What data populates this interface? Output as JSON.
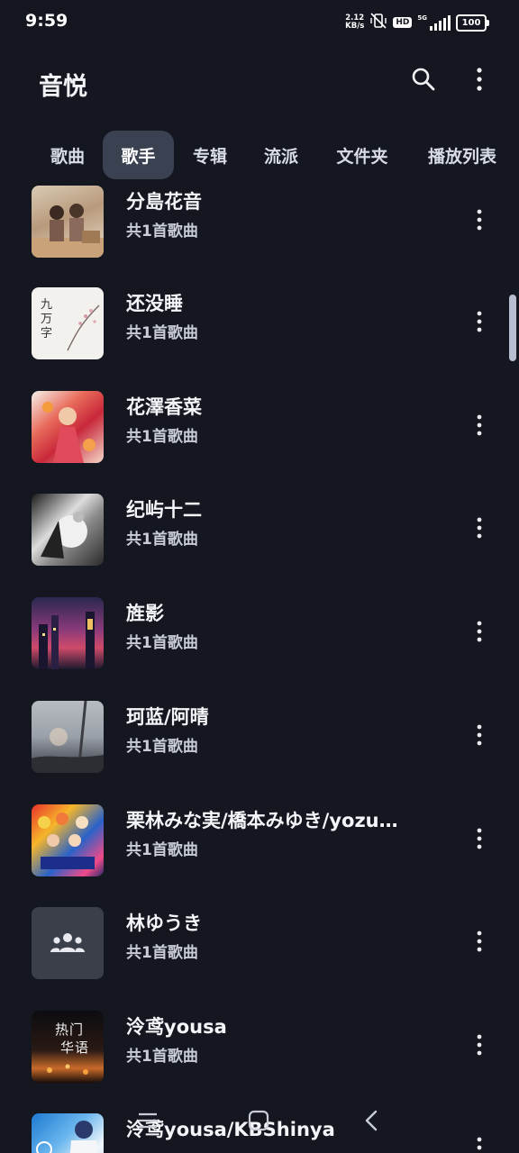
{
  "status_bar": {
    "time": "9:59",
    "net_speed_value": "2.12",
    "net_speed_unit": "KB/s",
    "hd_label": "HD",
    "signal_label": "5G",
    "battery": "100"
  },
  "app_bar": {
    "title": "音悦",
    "icons": [
      "search-icon",
      "more-vert-icon"
    ]
  },
  "tabs": [
    {
      "label": "歌曲",
      "active": false
    },
    {
      "label": "歌手",
      "active": true
    },
    {
      "label": "专辑",
      "active": false
    },
    {
      "label": "流派",
      "active": false
    },
    {
      "label": "文件夹",
      "active": false
    },
    {
      "label": "播放列表",
      "active": false
    }
  ],
  "artists": [
    {
      "name": "分島花音",
      "count": "共1首歌曲"
    },
    {
      "name": "还没睡",
      "count": "共1首歌曲"
    },
    {
      "name": "花澤香菜",
      "count": "共1首歌曲"
    },
    {
      "name": "纪屿十二",
      "count": "共1首歌曲"
    },
    {
      "name": "旌影",
      "count": "共1首歌曲"
    },
    {
      "name": "珂蓝/阿晴",
      "count": "共1首歌曲"
    },
    {
      "name": "栗林みな実/橋本みゆき/yozu…",
      "count": "共1首歌曲"
    },
    {
      "name": "林ゆうき",
      "count": "共1首歌曲"
    },
    {
      "name": "泠鸢yousa",
      "count": "共1首歌曲"
    },
    {
      "name": "泠鸢yousa/KBShinya",
      "count": ""
    }
  ],
  "thumb_text": {
    "row1": "九万字",
    "row8_line1": "热门",
    "row8_line2": "华语"
  },
  "colors": {
    "background": "#141720",
    "active_tab": "#3a4252",
    "placeholder_thumb": "#3b3f4a"
  },
  "nav_bar": {
    "icons": [
      "menu-icon",
      "home-square-icon",
      "back-chevron-icon"
    ]
  }
}
